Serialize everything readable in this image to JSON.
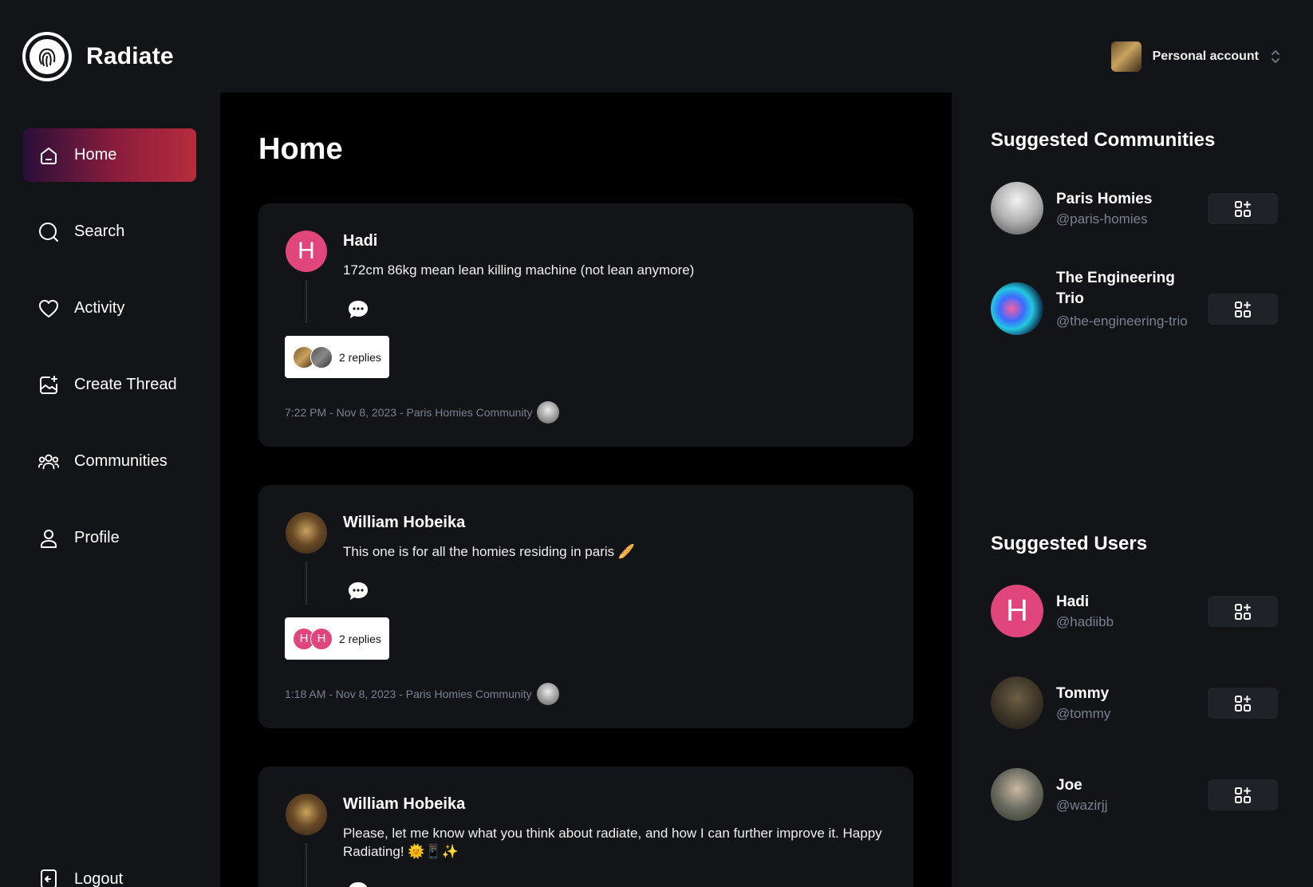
{
  "app": {
    "name": "Radiate",
    "account_label": "Personal account"
  },
  "sidebar": {
    "items": [
      {
        "label": "Home",
        "icon": "home-icon",
        "active": true
      },
      {
        "label": "Search",
        "icon": "search-icon",
        "active": false
      },
      {
        "label": "Activity",
        "icon": "heart-icon",
        "active": false
      },
      {
        "label": "Create Thread",
        "icon": "create-thread-icon",
        "active": false
      },
      {
        "label": "Communities",
        "icon": "communities-icon",
        "active": false
      },
      {
        "label": "Profile",
        "icon": "profile-icon",
        "active": false
      }
    ],
    "logout_label": "Logout"
  },
  "main": {
    "title": "Home",
    "posts": [
      {
        "author": "Hadi",
        "avatar_letter": "H",
        "text": "172cm 86kg mean lean killing machine (not lean anymore)",
        "replies_label": "2 replies",
        "meta": "7:22 PM - Nov 8, 2023 - Paris Homies Community"
      },
      {
        "author": "William Hobeika",
        "text": "This one is for all the homies residing in paris 🥖",
        "replies_label": "2 replies",
        "reply_avatar_letters": [
          "H",
          "H"
        ],
        "meta": "1:18 AM - Nov 8, 2023 - Paris Homies Community"
      },
      {
        "author": "William Hobeika",
        "text": "Please, let me know what you think about radiate, and how I can further improve it. Happy Radiating! 🌞📱✨"
      }
    ]
  },
  "rightbar": {
    "communities_title": "Suggested Communities",
    "communities": [
      {
        "name": "Paris Homies",
        "handle": "@paris-homies"
      },
      {
        "name": "The Engineering Trio",
        "handle": "@the-engineering-trio"
      }
    ],
    "users_title": "Suggested Users",
    "users": [
      {
        "name": "Hadi",
        "handle": "@hadiibb",
        "avatar_letter": "H"
      },
      {
        "name": "Tommy",
        "handle": "@tommy"
      },
      {
        "name": "Joe",
        "handle": "@wazirjj"
      }
    ]
  },
  "colors": {
    "accent_gradient_start": "#2a0f3a",
    "accent_gradient_end": "#b72c3c",
    "avatar_pink": "#e0457b",
    "muted_text": "#7b8190"
  }
}
